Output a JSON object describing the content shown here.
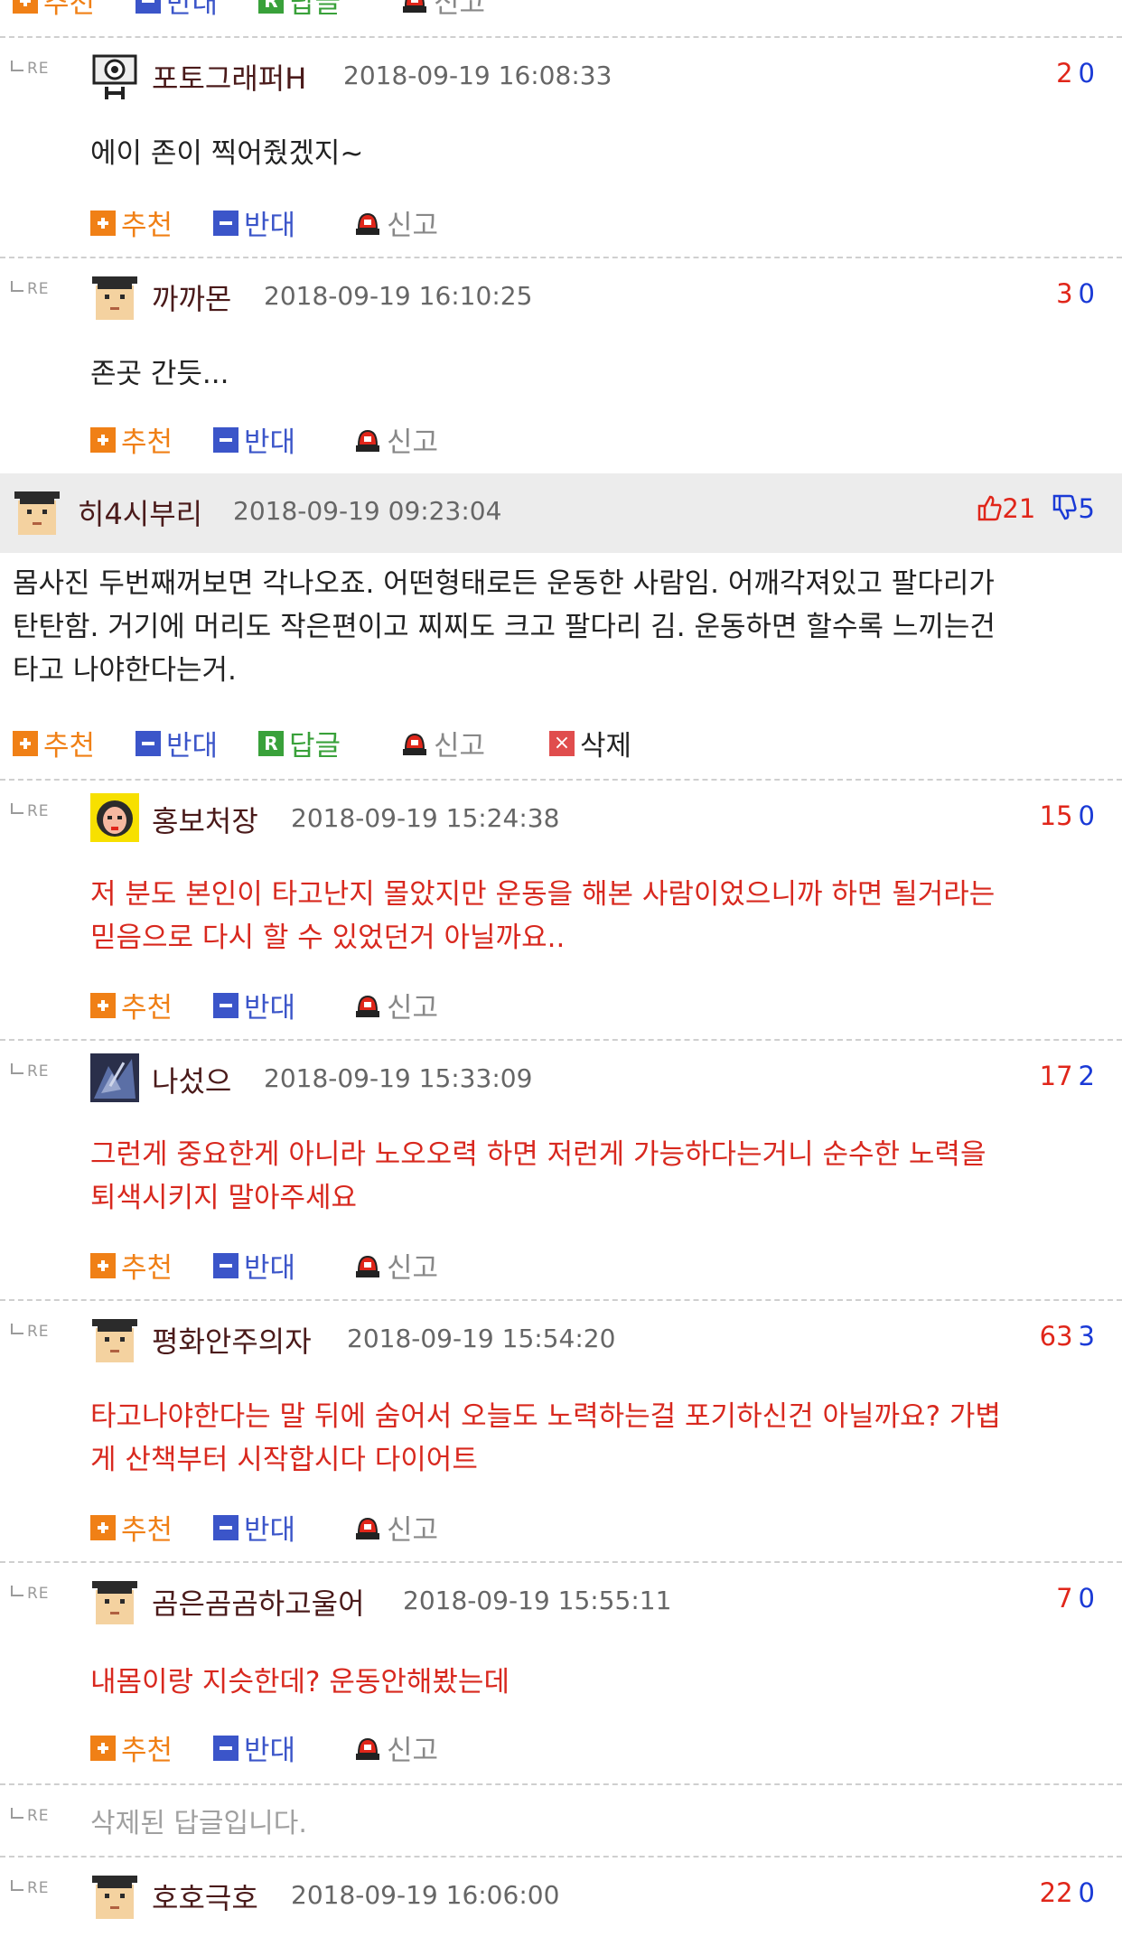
{
  "actions": {
    "recommend": "추천",
    "oppose": "반대",
    "reply": "답글",
    "reply_icon": "R",
    "report": "신고",
    "delete": "삭제",
    "delete_icon": "×"
  },
  "re_label": "RE",
  "colors": {
    "recommend": "#f08016",
    "oppose": "#3b55c9",
    "reply": "#39a13a",
    "up_count": "#e0261a",
    "down_count": "#1a3ad6",
    "reply_text": "#d8281e"
  },
  "top_partial": {
    "recommend": "추천",
    "oppose": "반대",
    "reply": "답글",
    "report": "신고"
  },
  "comments": [
    {
      "nick": "포토그래퍼H",
      "date": "2018-09-19 16:08:33",
      "up": "2",
      "down": "0",
      "text": [
        "에이 존이 찍어줬겠지~"
      ],
      "avatar": "camera-avatar"
    },
    {
      "nick": "까까몬",
      "date": "2018-09-19 16:10:25",
      "up": "3",
      "down": "0",
      "text": [
        "존곳 간듯..."
      ],
      "avatar": "default-avatar"
    }
  ],
  "parent": {
    "nick": "히4시부리",
    "date": "2018-09-19 09:23:04",
    "up": "21",
    "down": "5",
    "text": [
      "몸사진 두번째꺼보면 각나오죠. 어떤형태로든 운동한 사람임. 어깨각져있고 팔다리가",
      "탄탄함. 거기에 머리도 작은편이고 찌찌도 크고 팔다리 김. 운동하면 할수록 느끼는건",
      "타고 나야한다는거."
    ]
  },
  "replies": [
    {
      "nick": "홍보처장",
      "date": "2018-09-19 15:24:38",
      "up": "15",
      "down": "0",
      "text": [
        "저 분도 본인이 타고난지 몰았지만 운동을 해본 사람이었으니까 하면 될거라는",
        "믿음으로 다시 할 수 있었던거 아닐까요.."
      ]
    },
    {
      "nick": "나섰으",
      "date": "2018-09-19 15:33:09",
      "up": "17",
      "down": "2",
      "text": [
        "그런게 중요한게 아니라 노오오력 하면 저런게 가능하다는거니 순수한 노력을",
        "퇴색시키지 말아주세요"
      ]
    },
    {
      "nick": "평화안주의자",
      "date": "2018-09-19 15:54:20",
      "up": "63",
      "down": "3",
      "text": [
        "타고나야한다는 말 뒤에 숨어서 오늘도 노력하는걸 포기하신건 아닐까요? 가볍",
        "게 산책부터 시작합시다 다이어트"
      ]
    },
    {
      "nick": "곰은곰곰하고울어",
      "date": "2018-09-19 15:55:11",
      "up": "7",
      "down": "0",
      "text": [
        "내몸이랑 지슷한데? 운동안해봤는데"
      ]
    }
  ],
  "deleted_reply": "삭제된 답글입니다.",
  "last_reply": {
    "nick": "호호극호",
    "date": "2018-09-19 16:06:00",
    "up": "22",
    "down": "0"
  }
}
